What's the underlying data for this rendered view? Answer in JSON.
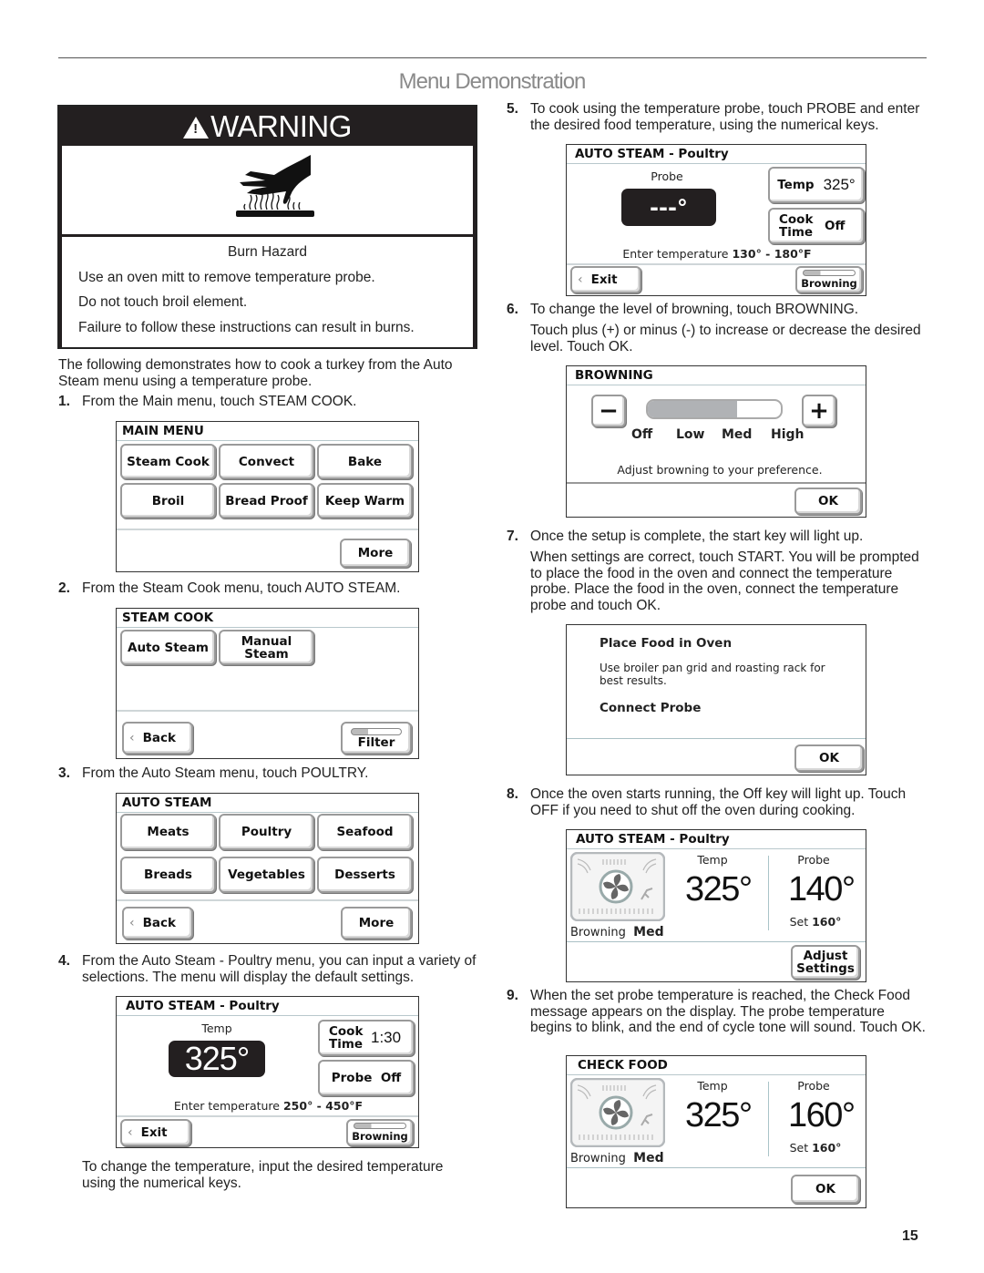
{
  "page": {
    "title": "Menu Demonstration",
    "page_number": "15"
  },
  "warning": {
    "heading": "WARNING",
    "icon": "burn-hazard-hand-icon",
    "hazard": "Burn Hazard",
    "lines": [
      "Use an oven mitt to remove temperature probe.",
      "Do not touch broil element.",
      "Failure to follow these instructions can result in burns."
    ]
  },
  "intro": "The following demonstrates how to cook a turkey from the Auto Steam menu using a temperature probe.",
  "steps": [
    {
      "n": "1.",
      "text": "From the Main menu, touch STEAM COOK."
    },
    {
      "n": "2.",
      "text": "From the Steam Cook menu, touch AUTO STEAM."
    },
    {
      "n": "3.",
      "text": "From the Auto Steam menu, touch POULTRY."
    },
    {
      "n": "4.",
      "text": "From the Auto Steam - Poultry menu, you can input a variety of selections. The menu will display the default settings."
    },
    {
      "n": "5.",
      "text": "To cook using the temperature probe, touch PROBE and enter the desired food temperature, using the numerical keys."
    },
    {
      "n": "6.",
      "text": "To change the level of browning, touch BROWNING."
    },
    {
      "n": "7.",
      "text": "Once the setup is complete, the start key will light up."
    },
    {
      "n": "8.",
      "text": "Once the oven starts running, the Off key will light up. Touch OFF if you need to shut off the oven during cooking."
    },
    {
      "n": "9.",
      "text": "When the set probe temperature is reached, the Check Food message appears on the display. The probe temperature begins to blink, and the end of cycle tone will sound. Touch OK."
    }
  ],
  "notes": {
    "step4_after": "To change the temperature, input the desired temperature using the numerical keys.",
    "step6_detail": "Touch  plus  (+) or  minus  (-) to increase or decrease the desired level. Touch OK.",
    "step7_detail": "When settings are correct, touch START. You will be prompted to place the food in the oven and connect the temperature probe. Place the food in the oven, connect the temperature probe and touch OK."
  },
  "panels": {
    "main_menu": {
      "title": "MAIN MENU",
      "buttons": [
        "Steam Cook",
        "Convect",
        "Bake",
        "Broil",
        "Bread Proof",
        "Keep Warm"
      ],
      "more": "More"
    },
    "steam_cook": {
      "title": "STEAM COOK",
      "buttons": [
        "Auto Steam",
        "Manual Steam"
      ],
      "back": "Back",
      "filter": "Filter"
    },
    "auto_steam": {
      "title": "AUTO STEAM",
      "buttons": [
        "Meats",
        "Poultry",
        "Seafood",
        "Breads",
        "Vegetables",
        "Desserts"
      ],
      "back": "Back",
      "more": "More"
    },
    "poultry_default": {
      "title": "AUTO STEAM - Poultry",
      "temp_label": "Temp",
      "temp_value": "325°",
      "cook_time_label": "Cook Time",
      "cook_time_value": "1:30",
      "probe_label": "Probe",
      "probe_value": "Off",
      "range_label": "Enter temperature",
      "range_value": "250° - 450°F",
      "exit": "Exit",
      "browning": "Browning"
    },
    "poultry_probe": {
      "title": "AUTO STEAM - Poultry",
      "probe_label": "Probe",
      "probe_value": "---°",
      "temp_label": "Temp",
      "temp_value": "325°",
      "cook_time_label": "Cook Time",
      "cook_time_value": "Off",
      "range_label": "Enter temperature",
      "range_value": "130° - 180°F",
      "exit": "Exit",
      "browning": "Browning"
    },
    "browning": {
      "title": "BROWNING",
      "minus": "−",
      "plus": "+",
      "levels": [
        "Off",
        "Low",
        "Med",
        "High"
      ],
      "current_level": "Med",
      "fill_fraction": 0.67,
      "hint": "Adjust browning to your preference.",
      "ok": "OK"
    },
    "place_food": {
      "heading": "Place Food in Oven",
      "text": "Use broiler pan grid and roasting rack for best results.",
      "connect": "Connect Probe",
      "ok": "OK"
    },
    "running": {
      "title": "AUTO STEAM - Poultry",
      "temp_label": "Temp",
      "temp_value": "325°",
      "probe_label": "Probe",
      "probe_value": "140°",
      "set_label": "Set",
      "set_value": "160°",
      "browning_label": "Browning",
      "browning_value": "Med",
      "adjust": "Adjust Settings"
    },
    "check_food": {
      "title": "CHECK  FOOD",
      "temp_label": "Temp",
      "temp_value": "325°",
      "probe_label": "Probe",
      "probe_value": "160°",
      "set_label": "Set",
      "set_value": "160°",
      "browning_label": "Browning",
      "browning_value": "Med",
      "ok": "OK"
    }
  }
}
